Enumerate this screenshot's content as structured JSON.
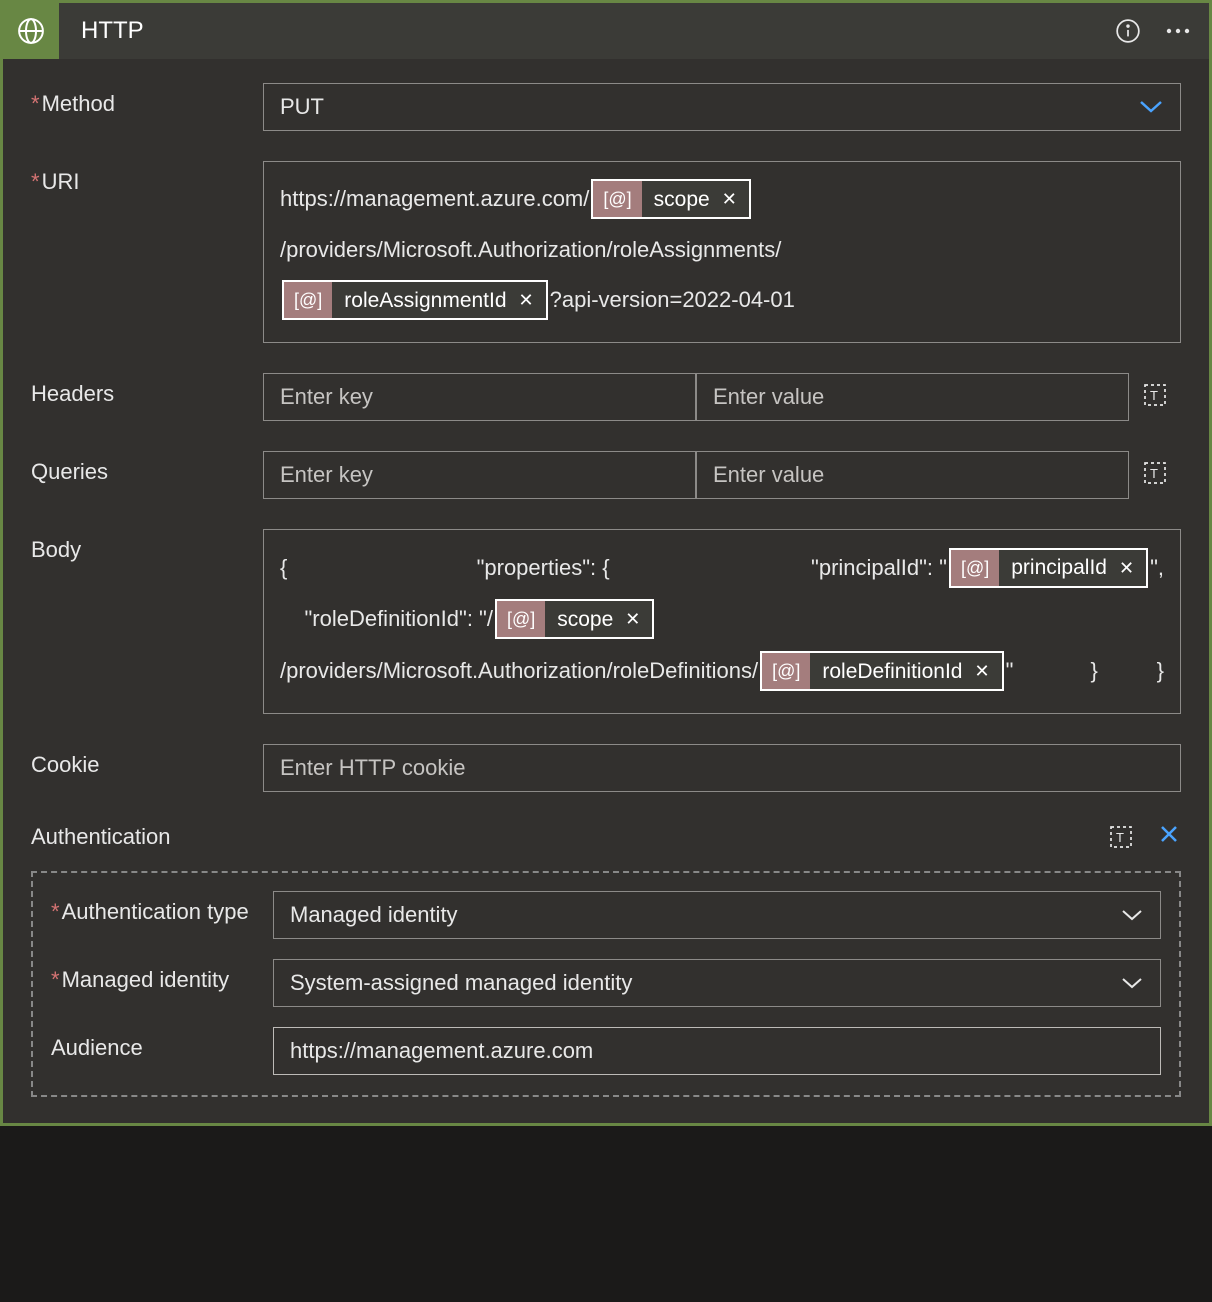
{
  "header": {
    "title": "HTTP"
  },
  "labels": {
    "method": "Method",
    "uri": "URI",
    "headers": "Headers",
    "queries": "Queries",
    "body": "Body",
    "cookie": "Cookie",
    "authentication": "Authentication",
    "authType": "Authentication type",
    "managedIdentity": "Managed identity",
    "audience": "Audience"
  },
  "method": {
    "value": "PUT"
  },
  "uri": {
    "part1": "https://management.azure.com/",
    "token1": "scope",
    "part2": "/providers/Microsoft.Authorization/roleAssignments/",
    "token2": "roleAssignmentId",
    "part3": "?api-version=2022-04-01"
  },
  "headers": {
    "keyPlaceholder": "Enter key",
    "valuePlaceholder": "Enter value"
  },
  "queries": {
    "keyPlaceholder": "Enter key",
    "valuePlaceholder": "Enter value"
  },
  "body": {
    "l1": "{",
    "l2": "  \"properties\": {",
    "l3a": "    \"principalId\": \"",
    "l3tok": "principalId",
    "l3b": "\",",
    "l4a": "    \"roleDefinitionId\": \"/",
    "l4tok": "scope",
    "l5a": "/providers/Microsoft.Authorization/roleDefinitions/",
    "l5tok": "roleDefinitionId",
    "l5b": "\"",
    "l6": "   }",
    "l7": "}"
  },
  "cookie": {
    "placeholder": "Enter HTTP cookie"
  },
  "auth": {
    "typeValue": "Managed identity",
    "managedIdentityValue": "System-assigned managed identity",
    "audienceValue": "https://management.azure.com"
  },
  "tokenGlyph": "[@]"
}
